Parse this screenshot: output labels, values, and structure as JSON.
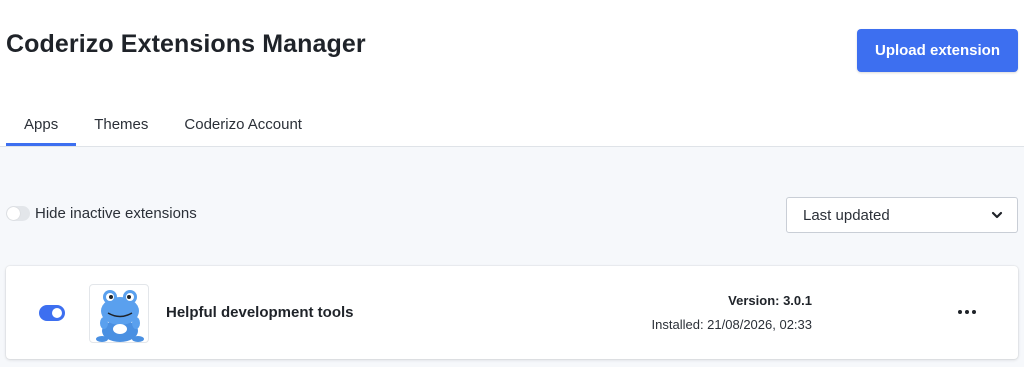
{
  "header": {
    "title": "Coderizo Extensions Manager",
    "upload_label": "Upload extension"
  },
  "tabs": [
    {
      "label": "Apps",
      "active": true
    },
    {
      "label": "Themes",
      "active": false
    },
    {
      "label": "Coderizo Account",
      "active": false
    }
  ],
  "filters": {
    "hide_inactive_label": "Hide inactive extensions",
    "hide_inactive_enabled": false,
    "sort_selected": "Last updated"
  },
  "extensions": [
    {
      "name": "Helpful development tools",
      "enabled": true,
      "icon": "frog-mascot-icon",
      "version": "Version: 3.0.1",
      "installed": "Installed: 21/08/2026, 02:33"
    }
  ],
  "colors": {
    "accent": "#3d6ff0",
    "background": "#f6f8fb",
    "mascot": "#4a90e2"
  }
}
